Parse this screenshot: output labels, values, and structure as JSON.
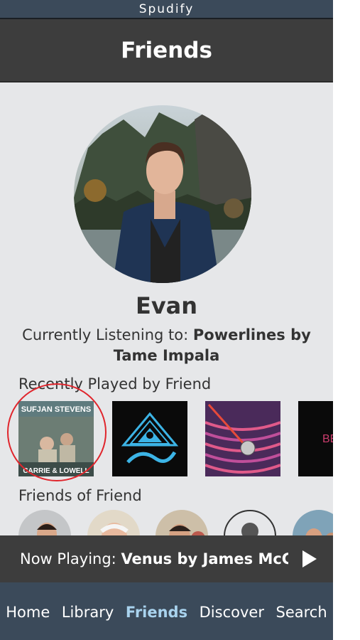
{
  "app": {
    "status_title": "Spudify"
  },
  "header": {
    "title": "Friends"
  },
  "profile": {
    "name": "Evan",
    "listening_prefix": "Currently Listening to: ",
    "listening_track": "Powerlines by",
    "listening_artist": "Tame Impala"
  },
  "recently_played": {
    "title": "Recently Played by Friend",
    "albums": [
      {
        "artist_text": "SUFJAN STEVENS",
        "title_text": "CARRIE & LOWELL"
      },
      {
        "artist_text": ""
      },
      {
        "artist_text": ""
      },
      {
        "artist_text": "BEY"
      }
    ]
  },
  "friends_of_friend": {
    "title": "Friends of Friend"
  },
  "now_playing": {
    "prefix": "Now Playing: ",
    "track": "Venus by James McCall"
  },
  "nav": {
    "items": [
      {
        "label": "Home"
      },
      {
        "label": "Library"
      },
      {
        "label": "Friends"
      },
      {
        "label": "Discover"
      },
      {
        "label": "Search"
      }
    ]
  },
  "colors": {
    "accent": "#a9d3ee",
    "annotation": "#e0252c"
  }
}
